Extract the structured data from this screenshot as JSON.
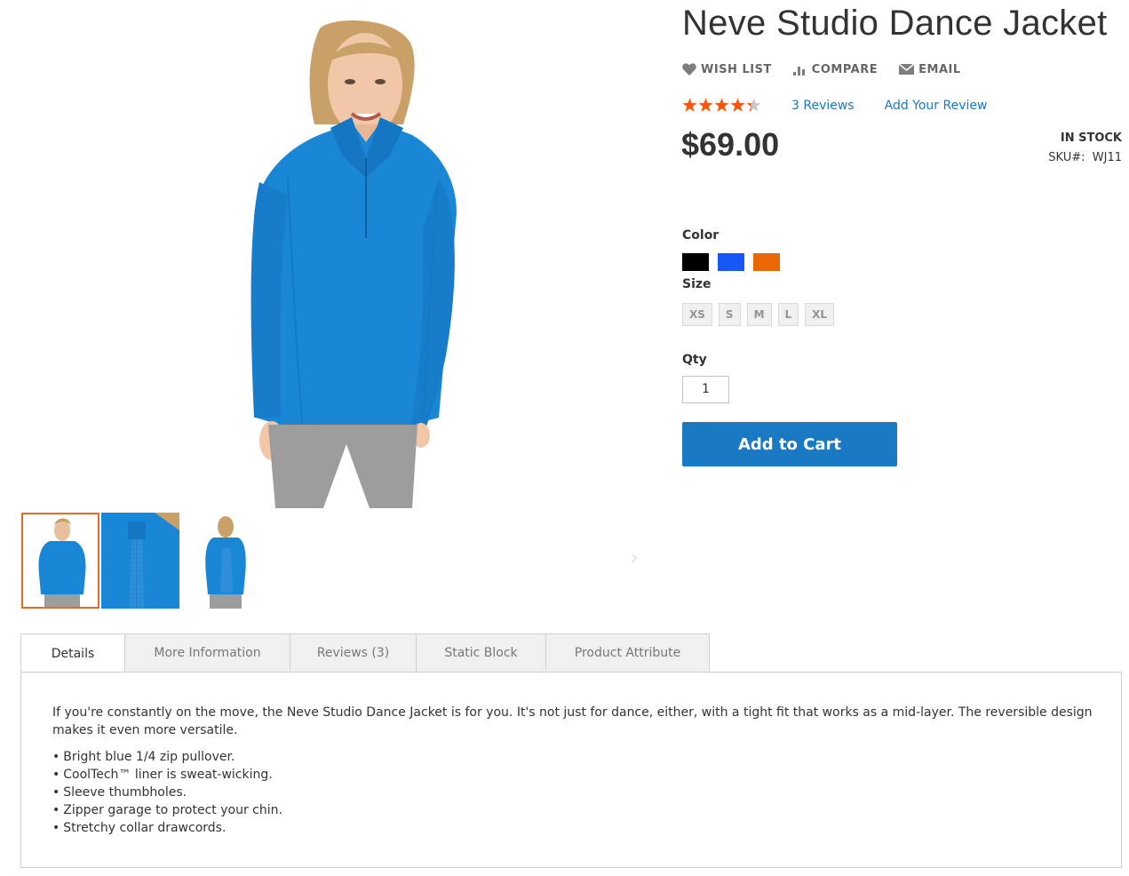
{
  "product": {
    "title": "Neve Studio Dance Jacket",
    "price": "$69.00",
    "stock": "IN STOCK",
    "sku_label": "SKU#:",
    "sku_value": "WJ11",
    "rating": 4.3
  },
  "actions": {
    "wishlist": "WISH LIST",
    "compare": "COMPARE",
    "email": "EMAIL"
  },
  "reviews": {
    "count_link": "3 Reviews",
    "add_link": "Add Your Review"
  },
  "options": {
    "color_label": "Color",
    "colors": [
      {
        "name": "black",
        "hex": "#000000"
      },
      {
        "name": "blue",
        "hex": "#1857f7"
      },
      {
        "name": "orange",
        "hex": "#eb6703"
      }
    ],
    "size_label": "Size",
    "sizes": [
      "XS",
      "S",
      "M",
      "L",
      "XL"
    ],
    "qty_label": "Qty",
    "qty_value": "1"
  },
  "cart": {
    "button_label": "Add to Cart"
  },
  "gallery": {
    "thumb_prev": "‹",
    "thumb_next": "›"
  },
  "tabs": {
    "items": [
      "Details",
      "More Information",
      "Reviews (3)",
      "Static Block",
      "Product Attribute"
    ],
    "active": "Details"
  },
  "details": {
    "description": "If you're constantly on the move, the Neve Studio Dance Jacket is for you. It's not just for dance, either, with a tight fit that works as a mid-layer. The reversible design makes it even more versatile.",
    "bullets": [
      "Bright blue 1/4 zip pullover.",
      "CoolTech™ liner is sweat-wicking.",
      "Sleeve thumbholes.",
      "Zipper garage to protect your chin.",
      "Stretchy collar drawcords."
    ]
  },
  "colors": {
    "link": "#1979c3",
    "primary_button": "#1979c3",
    "star": "#ff5501",
    "active_thumb_border": "#e86b25"
  }
}
